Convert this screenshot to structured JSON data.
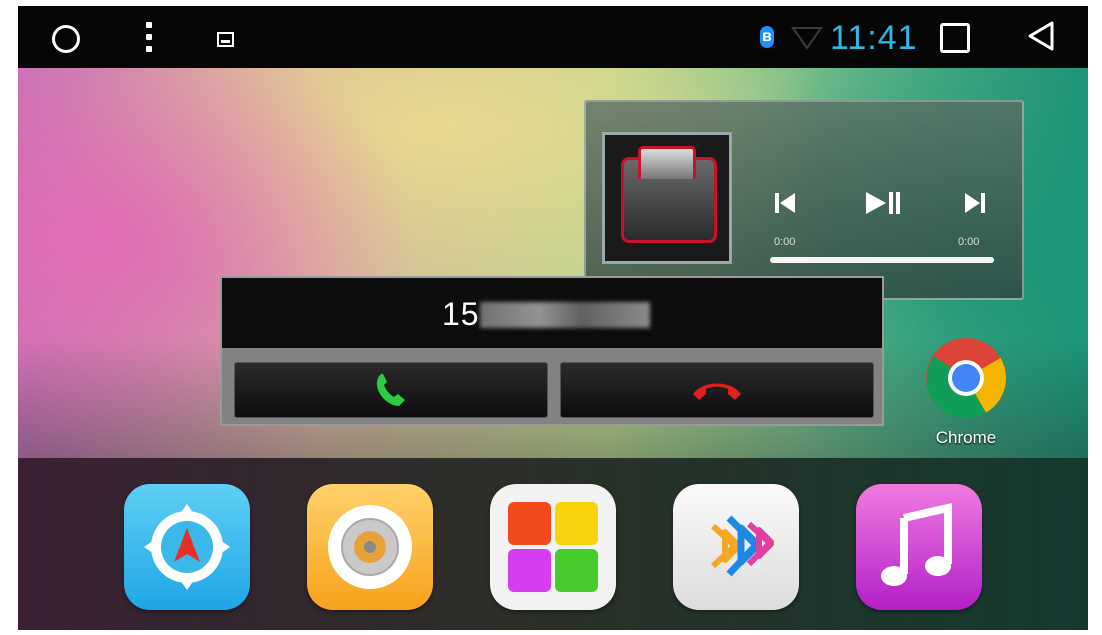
{
  "status_bar": {
    "time": "11:41",
    "icons": [
      "home-circle-icon",
      "menu-dots-icon",
      "screenshot-icon",
      "bluetooth-icon",
      "wifi-icon",
      "recents-icon",
      "back-icon"
    ],
    "accent_color": "#2db8e0"
  },
  "music_widget": {
    "time_start": "0:00",
    "time_end": "0:00",
    "progress": 0,
    "controls": [
      "previous-icon",
      "play-pause-icon",
      "next-icon"
    ]
  },
  "incoming_call": {
    "number_prefix": "15",
    "accept_color": "#2ecc40",
    "decline_color": "#e0201c"
  },
  "shortcut": {
    "label": "Chrome"
  },
  "dock": {
    "apps": [
      "navigation-app-icon",
      "radio-app-icon",
      "gallery-app-icon",
      "bluetooth-app-icon",
      "music-app-icon"
    ]
  }
}
